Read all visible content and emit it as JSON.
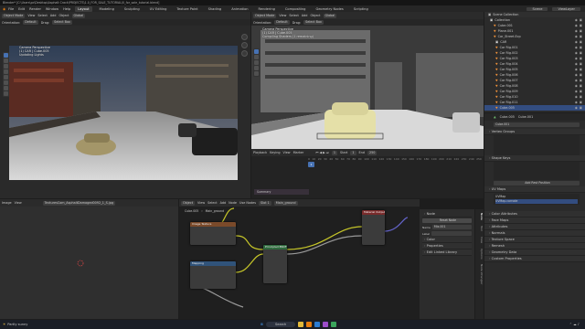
{
  "window": {
    "title": "Blender* [C:\\Users\\pc\\Desktop\\Asphalt Crack\\PROJECTS\\1.0_FOR_SALE_TUTORIAL\\0_for_sale_tutorial.blend]"
  },
  "menu": {
    "items": [
      "File",
      "Edit",
      "Render",
      "Window",
      "Help"
    ],
    "workspaces": [
      "Layout",
      "Modeling",
      "Sculpting",
      "UV Editing",
      "Texture Paint",
      "Shading",
      "Animation",
      "Rendering",
      "Compositing",
      "Geometry Nodes",
      "Scripting"
    ],
    "active_workspace": "Layout",
    "scene": "Scene",
    "view_layer": "ViewLayer"
  },
  "viewport_left": {
    "header": [
      "Object Mode",
      "View",
      "Select",
      "Add",
      "Object",
      "Global"
    ],
    "sub_header": [
      "Orientation:",
      "Default",
      "Drag:",
      "Select Box"
    ],
    "overlay": [
      "Camera Perspective",
      "(1) CAR | Cube.005",
      "Updating Lights"
    ]
  },
  "viewport_right": {
    "header": [
      "Object Mode",
      "View",
      "Select",
      "Add",
      "Object",
      "Global"
    ],
    "sub_header": [
      "Orientation:",
      "Default",
      "Drag:",
      "Select Box"
    ],
    "overlay": [
      "Camera Perspective",
      "(1) CAR | Cube.005",
      "Compiling Shaders (1 remaining)"
    ]
  },
  "timeline": {
    "menu": [
      "Playback",
      "Keying",
      "View",
      "Marker"
    ],
    "frame": "1",
    "start": "Start",
    "start_val": "1",
    "end": "End",
    "end_val": "250",
    "ticks": [
      "0",
      "10",
      "20",
      "30",
      "40",
      "50",
      "60",
      "70",
      "80",
      "90",
      "100",
      "110",
      "120",
      "130",
      "140",
      "150",
      "160",
      "170",
      "180",
      "190",
      "200",
      "210",
      "220",
      "230",
      "240",
      "250"
    ],
    "summary": "Summary"
  },
  "image_editor": {
    "menu": [
      "Image",
      "View"
    ],
    "image_name": "TexturesCom_AsphaltDamaged0092_1_S.jpg"
  },
  "node_editor": {
    "menu": [
      "Object",
      "View",
      "Select",
      "Add",
      "Node",
      "Use Nodes",
      "Slot 1"
    ],
    "material": "Main_ground",
    "breadcrumb": [
      "Cube.005",
      "Main_ground"
    ],
    "nodes": {
      "a": "Image Texture",
      "b": "Mapping",
      "c": "Principled BSDF",
      "d": "Material Output"
    },
    "tabs": [
      "Node",
      "Tool",
      "View",
      "Options",
      "Node Wrangler"
    ]
  },
  "node_panel": {
    "title": "Node",
    "reset": "Reset Node",
    "name_label": "Name",
    "name_val": "Mix.001",
    "label_label": "Label",
    "color": "Color",
    "properties": "Properties",
    "edit_linked": "Edit Linked Library"
  },
  "outliner": {
    "title": "Scene Collection",
    "rows": [
      {
        "name": "Collection",
        "sel": false
      },
      {
        "name": "Cube.001",
        "sel": false
      },
      {
        "name": "Plane.001",
        "sel": false
      },
      {
        "name": "Car_Street.Ecp",
        "sel": false
      },
      {
        "name": "CAR",
        "sel": false
      },
      {
        "name": "Car Rig.001",
        "sel": false
      },
      {
        "name": "Car Rig.002",
        "sel": false
      },
      {
        "name": "Car Rig.003",
        "sel": false
      },
      {
        "name": "Car Rig.004",
        "sel": false
      },
      {
        "name": "Car Rig.005",
        "sel": false
      },
      {
        "name": "Car Rig.006",
        "sel": false
      },
      {
        "name": "Car Rig.007",
        "sel": false
      },
      {
        "name": "Car Rig.008",
        "sel": false
      },
      {
        "name": "Car Rig.009",
        "sel": false
      },
      {
        "name": "Car Rig.010",
        "sel": false
      },
      {
        "name": "Car Rig.011",
        "sel": false
      },
      {
        "name": "Cube.005",
        "sel": true
      }
    ]
  },
  "properties": {
    "object": "Cube.005",
    "mesh": "Cube.001",
    "sections": [
      "Vertex Groups",
      "Shape Keys",
      "UV Maps",
      "Attributes",
      "Normals",
      "Texture Space",
      "Remesh",
      "Geometry Data",
      "Custom Properties"
    ],
    "add_rest": "Add Rest Position",
    "uv_items": [
      "UVMap",
      "UVMap.corrode"
    ],
    "color_attributes": "Color Attributes",
    "face_maps": "Face Maps"
  },
  "taskbar": {
    "weather": "Partly sunny",
    "search": "Search",
    "time": "",
    "colors": {
      "accent": "#4772b3"
    }
  },
  "colors": {
    "accent": "#4772b3",
    "selection": "#334d80",
    "wire_yellow": "#c7c729",
    "wire_grey": "#9a9a9a",
    "wire_blue": "#6363c7"
  }
}
